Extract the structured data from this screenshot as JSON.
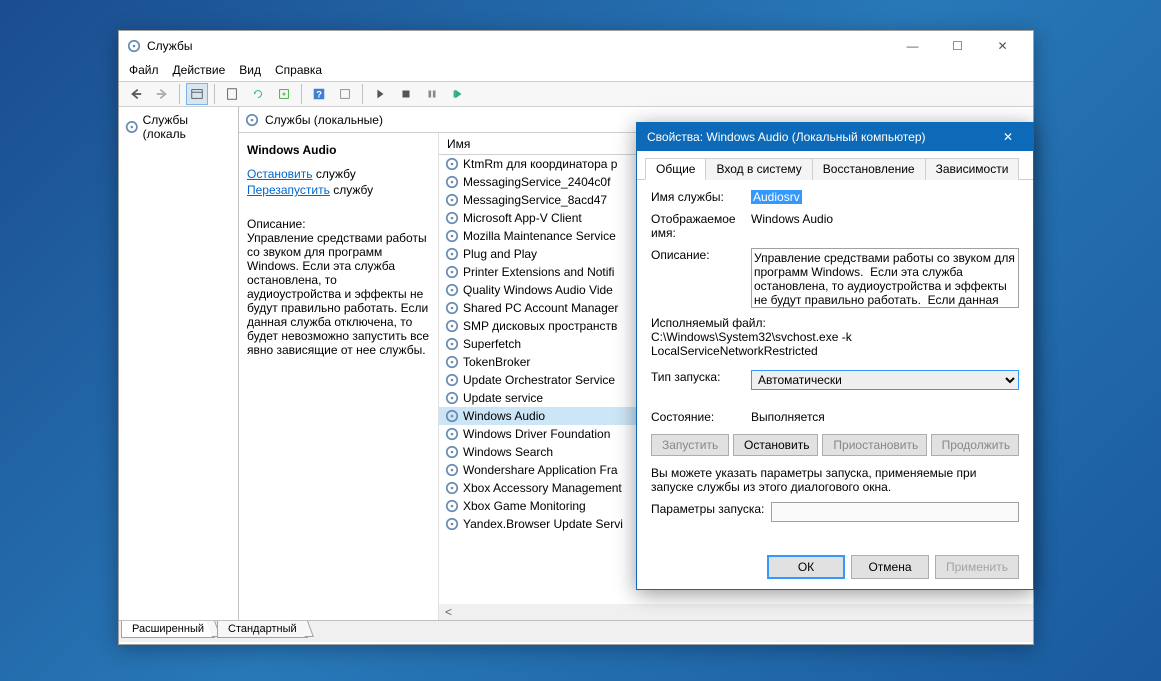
{
  "main_window": {
    "title": "Службы",
    "menu": [
      "Файл",
      "Действие",
      "Вид",
      "Справка"
    ],
    "tree_item": "Службы (локаль",
    "panel_header": "Службы (локальные)"
  },
  "info": {
    "service_name": "Windows Audio",
    "action_stop": "Остановить",
    "action_restart": "Перезапустить",
    "action_suffix": " службу",
    "desc_label": "Описание:",
    "description": "Управление средствами работы со звуком для программ Windows. Если эта служба остановлена, то аудиоустройства и эффекты не будут правильно работать. Если данная служба отключена, то будет невозможно запустить все явно зависящие от нее службы."
  },
  "list_header": "Имя",
  "services": [
    "KtmRm для координатора р",
    "MessagingService_2404c0f",
    "MessagingService_8acd47",
    "Microsoft App-V Client",
    "Mozilla Maintenance Service",
    "Plug and Play",
    "Printer Extensions and Notifi",
    "Quality Windows Audio Vide",
    "Shared PC Account Manager",
    "SMP дисковых пространств",
    "Superfetch",
    "TokenBroker",
    "Update Orchestrator Service",
    "Update service",
    "Windows Audio",
    "Windows Driver Foundation",
    "Windows Search",
    "Wondershare Application Fra",
    "Xbox Accessory Management",
    "Xbox Game Monitoring",
    "Yandex.Browser Update Servi"
  ],
  "selected_index": 14,
  "bottom_tabs": {
    "extended": "Расширенный",
    "standard": "Стандартный"
  },
  "dialog": {
    "title": "Свойства: Windows Audio (Локальный компьютер)",
    "tabs": [
      "Общие",
      "Вход в систему",
      "Восстановление",
      "Зависимости"
    ],
    "labels": {
      "service_name": "Имя службы:",
      "display_name": "Отображаемое имя:",
      "description": "Описание:",
      "exe": "Исполняемый файл:",
      "startup": "Тип запуска:",
      "state": "Состояние:",
      "params": "Параметры запуска:"
    },
    "values": {
      "service_name": "Audiosrv",
      "display_name": "Windows Audio",
      "description": "Управление средствами работы со звуком для программ Windows.  Если эта служба остановлена, то аудиоустройства и эффекты не будут правильно работать.  Если данная служба",
      "exe": "C:\\Windows\\System32\\svchost.exe -k LocalServiceNetworkRestricted",
      "startup": "Автоматически",
      "state": "Выполняется"
    },
    "buttons": {
      "start": "Запустить",
      "stop": "Остановить",
      "pause": "Приостановить",
      "resume": "Продолжить",
      "ok": "ОК",
      "cancel": "Отмена",
      "apply": "Применить"
    },
    "hint": "Вы можете указать параметры запуска, применяемые при запуске службы из этого диалогового окна."
  }
}
